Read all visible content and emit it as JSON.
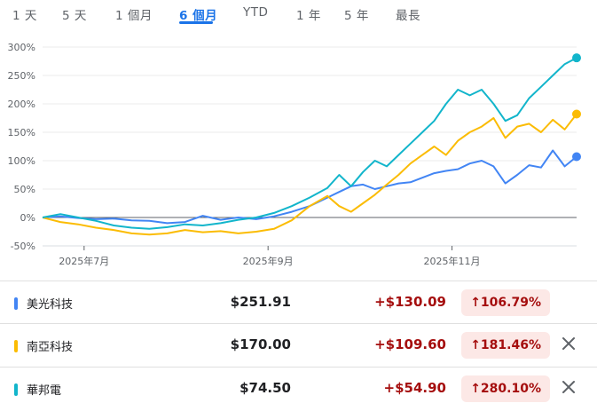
{
  "tabs": [
    {
      "label": "1 天",
      "active": false
    },
    {
      "label": "5 天",
      "active": false
    },
    {
      "label": "1 個月",
      "active": false
    },
    {
      "label": "6 個月",
      "active": true
    },
    {
      "label": "YTD",
      "active": false
    },
    {
      "label": "1 年",
      "active": false
    },
    {
      "label": "5 年",
      "active": false
    },
    {
      "label": "最長",
      "active": false
    }
  ],
  "chart_data": {
    "type": "line",
    "ylim": [
      -50,
      300
    ],
    "yticks": [
      -50,
      0,
      50,
      100,
      150,
      200,
      250,
      300
    ],
    "ytick_labels": [
      "-50%",
      "0%",
      "50%",
      "100%",
      "150%",
      "200%",
      "250%",
      "300%"
    ],
    "xlim": [
      0,
      180
    ],
    "xticks": [
      {
        "x": 14,
        "label": "2025年7月"
      },
      {
        "x": 76,
        "label": "2025年9月"
      },
      {
        "x": 138,
        "label": "2025年11月"
      }
    ],
    "grid": true,
    "series": [
      {
        "name": "美光科技",
        "color": "#4285f4",
        "x": [
          0,
          6,
          12,
          18,
          24,
          30,
          36,
          42,
          48,
          54,
          60,
          66,
          72,
          78,
          84,
          90,
          96,
          100,
          104,
          108,
          112,
          116,
          120,
          124,
          128,
          132,
          136,
          140,
          144,
          148,
          152,
          156,
          160,
          164,
          168,
          172,
          176,
          180
        ],
        "values": [
          0,
          2,
          -1,
          -3,
          -2,
          -5,
          -6,
          -10,
          -8,
          3,
          -4,
          0,
          -3,
          2,
          10,
          20,
          35,
          45,
          55,
          58,
          50,
          55,
          60,
          62,
          70,
          78,
          82,
          85,
          95,
          100,
          90,
          60,
          75,
          92,
          88,
          118,
          90,
          107
        ]
      },
      {
        "name": "南亞科技",
        "color": "#fbbc04",
        "x": [
          0,
          6,
          12,
          18,
          24,
          30,
          36,
          42,
          48,
          54,
          60,
          66,
          72,
          78,
          84,
          90,
          96,
          100,
          104,
          108,
          112,
          116,
          120,
          124,
          128,
          132,
          136,
          140,
          144,
          148,
          152,
          156,
          160,
          164,
          168,
          172,
          176,
          180
        ],
        "values": [
          0,
          -8,
          -12,
          -18,
          -22,
          -28,
          -30,
          -28,
          -22,
          -26,
          -24,
          -28,
          -25,
          -20,
          -5,
          20,
          38,
          20,
          10,
          25,
          40,
          58,
          75,
          95,
          110,
          125,
          110,
          135,
          150,
          160,
          175,
          140,
          160,
          165,
          150,
          172,
          155,
          182
        ]
      },
      {
        "name": "華邦電",
        "color": "#12b5cb",
        "x": [
          0,
          6,
          12,
          18,
          24,
          30,
          36,
          42,
          48,
          54,
          60,
          66,
          72,
          78,
          84,
          90,
          96,
          100,
          104,
          108,
          112,
          116,
          120,
          124,
          128,
          132,
          136,
          140,
          144,
          148,
          152,
          156,
          160,
          164,
          168,
          172,
          176,
          180
        ],
        "values": [
          0,
          6,
          0,
          -6,
          -14,
          -18,
          -20,
          -17,
          -12,
          -14,
          -10,
          -4,
          0,
          8,
          20,
          35,
          52,
          75,
          55,
          80,
          100,
          90,
          110,
          130,
          150,
          170,
          200,
          225,
          215,
          225,
          200,
          170,
          180,
          210,
          230,
          250,
          270,
          281
        ]
      }
    ]
  },
  "rows": [
    {
      "name": "美光科技",
      "price": "$251.91",
      "change": "+$130.09",
      "pct": "↑106.79%",
      "color": "#4285f4",
      "closable": false
    },
    {
      "name": "南亞科技",
      "price": "$170.00",
      "change": "+$109.60",
      "pct": "↑181.46%",
      "color": "#fbbc04",
      "closable": true
    },
    {
      "name": "華邦電",
      "price": "$74.50",
      "change": "+$54.90",
      "pct": "↑280.10%",
      "color": "#12b5cb",
      "closable": true
    }
  ]
}
